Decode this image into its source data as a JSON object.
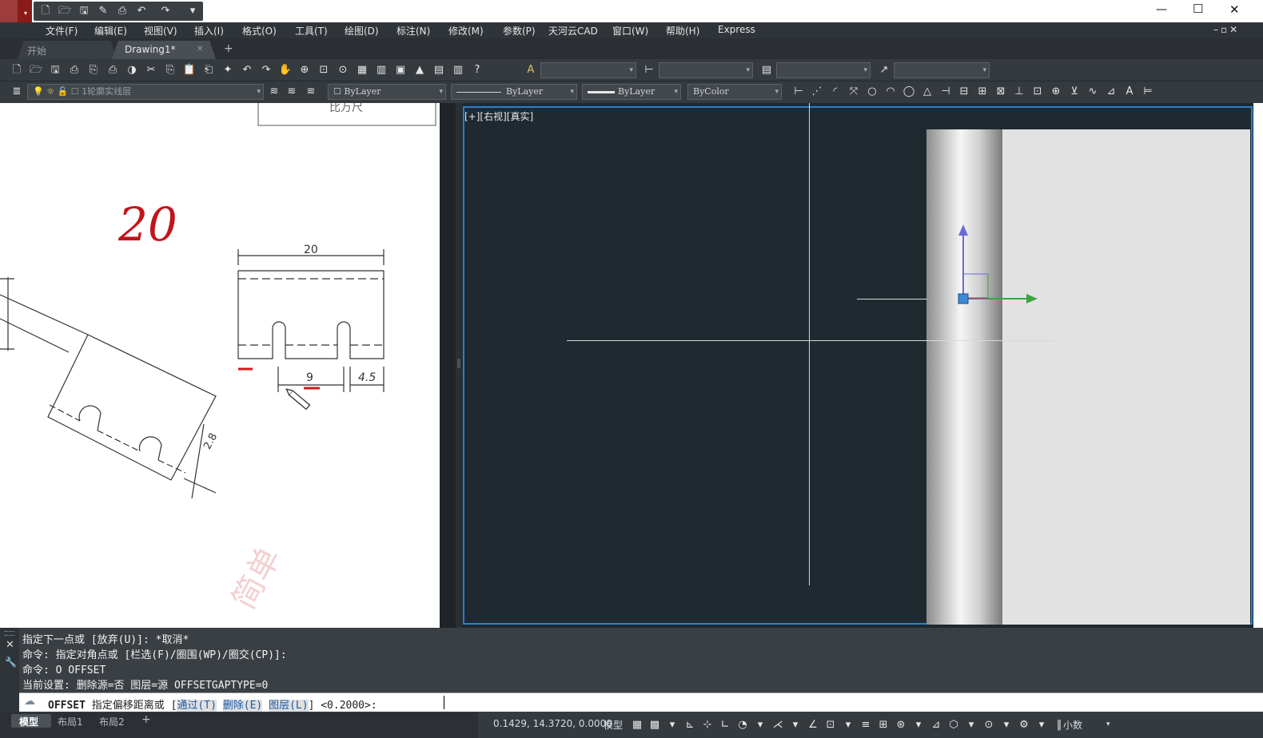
{
  "app": {
    "menus": [
      "文件(F)",
      "编辑(E)",
      "视图(V)",
      "插入(I)",
      "格式(O)",
      "工具(T)",
      "绘图(D)",
      "标注(N)",
      "修改(M)",
      "参数(P)",
      "天河云CAD",
      "窗口(W)",
      "帮助(H)",
      "Express"
    ],
    "window_controls": {
      "minimize": "—",
      "maximize": "☐",
      "close": "✕"
    },
    "doc_controls": "–▫✕"
  },
  "tabs": {
    "start": "开始",
    "drawing": "Drawing1*",
    "close": "✕",
    "add": "+"
  },
  "layers": {
    "current": "1轮廓实线层",
    "linetype_color": "ByLayer",
    "linetype": "ByLayer",
    "lineweight": "ByLayer",
    "plotstyle": "ByColor"
  },
  "viewport": {
    "label": "[+][右视][真实]",
    "colors": {
      "background": "#1f2930",
      "frame": "#2a7fd4",
      "x_axis": "#3fa33f",
      "z_axis": "#6a6ad8"
    }
  },
  "reference": {
    "handwriting": "20",
    "dim_top": "20",
    "dim_9": "9",
    "dim_45": "4.5",
    "dim_28": "2.8",
    "title_frag": "比万尺"
  },
  "command": {
    "history": [
      "指定下一点或 [放弃(U)]: *取消*",
      "命令: 指定对角点或 [栏选(F)/圈围(WP)/圈交(CP)]:",
      "命令: O OFFSET",
      "当前设置: 删除源=否  图层=源  OFFSETGAPTYPE=0"
    ],
    "prompt_cmd": "OFFSET",
    "prompt_text": "指定偏移距离或 [",
    "opt1": "通过(T)",
    "opt2": "删除(E)",
    "opt3": "图层(L)",
    "prompt_tail": "] <0.2000>:"
  },
  "status": {
    "tabs": [
      "模型",
      "布局1",
      "布局2"
    ],
    "add": "+",
    "coords": "0.1429, 14.3720, 0.0000",
    "space": "模型",
    "units": "小数"
  }
}
